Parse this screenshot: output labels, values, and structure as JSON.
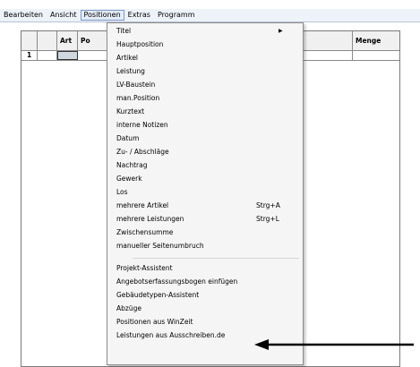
{
  "menubar": {
    "items": [
      {
        "label": "Bearbeiten"
      },
      {
        "label": "Ansicht"
      },
      {
        "label": "Positionen"
      },
      {
        "label": "Extras"
      },
      {
        "label": "Programm"
      }
    ]
  },
  "grid": {
    "headers": {
      "art": "Art",
      "pos": "Po",
      "menge": "Menge"
    },
    "row1_number": "1"
  },
  "menu": {
    "items": [
      {
        "label": "Titel",
        "has_submenu": true
      },
      {
        "label": "Hauptposition"
      },
      {
        "label": "Artikel"
      },
      {
        "label": "Leistung"
      },
      {
        "label": "LV-Baustein"
      },
      {
        "label": "man.Position"
      },
      {
        "label": "Kurztext"
      },
      {
        "label": "interne Notizen"
      },
      {
        "label": "Datum"
      },
      {
        "label": "Zu- / Abschläge"
      },
      {
        "label": "Nachtrag"
      },
      {
        "label": "Gewerk"
      },
      {
        "label": "Los"
      },
      {
        "label": "mehrere Artikel",
        "shortcut": "Strg+A"
      },
      {
        "label": "mehrere Leistungen",
        "shortcut": "Strg+L"
      },
      {
        "label": "Zwischensumme"
      },
      {
        "label": "manueller Seitenumbruch"
      },
      {
        "label": "Projekt-Assistent"
      },
      {
        "label": "Angebotserfassungsbogen einfügen"
      },
      {
        "label": "Gebäudetypen-Assistent"
      },
      {
        "label": "Abzüge"
      },
      {
        "label": "Positionen aus WinZeit"
      },
      {
        "label": "Leistungen aus Ausschreiben.de"
      }
    ]
  },
  "colors": {
    "menubar": "#eef3fa",
    "menu_bg": "#f5f5f5",
    "highlight_border": "#7d99c4"
  }
}
